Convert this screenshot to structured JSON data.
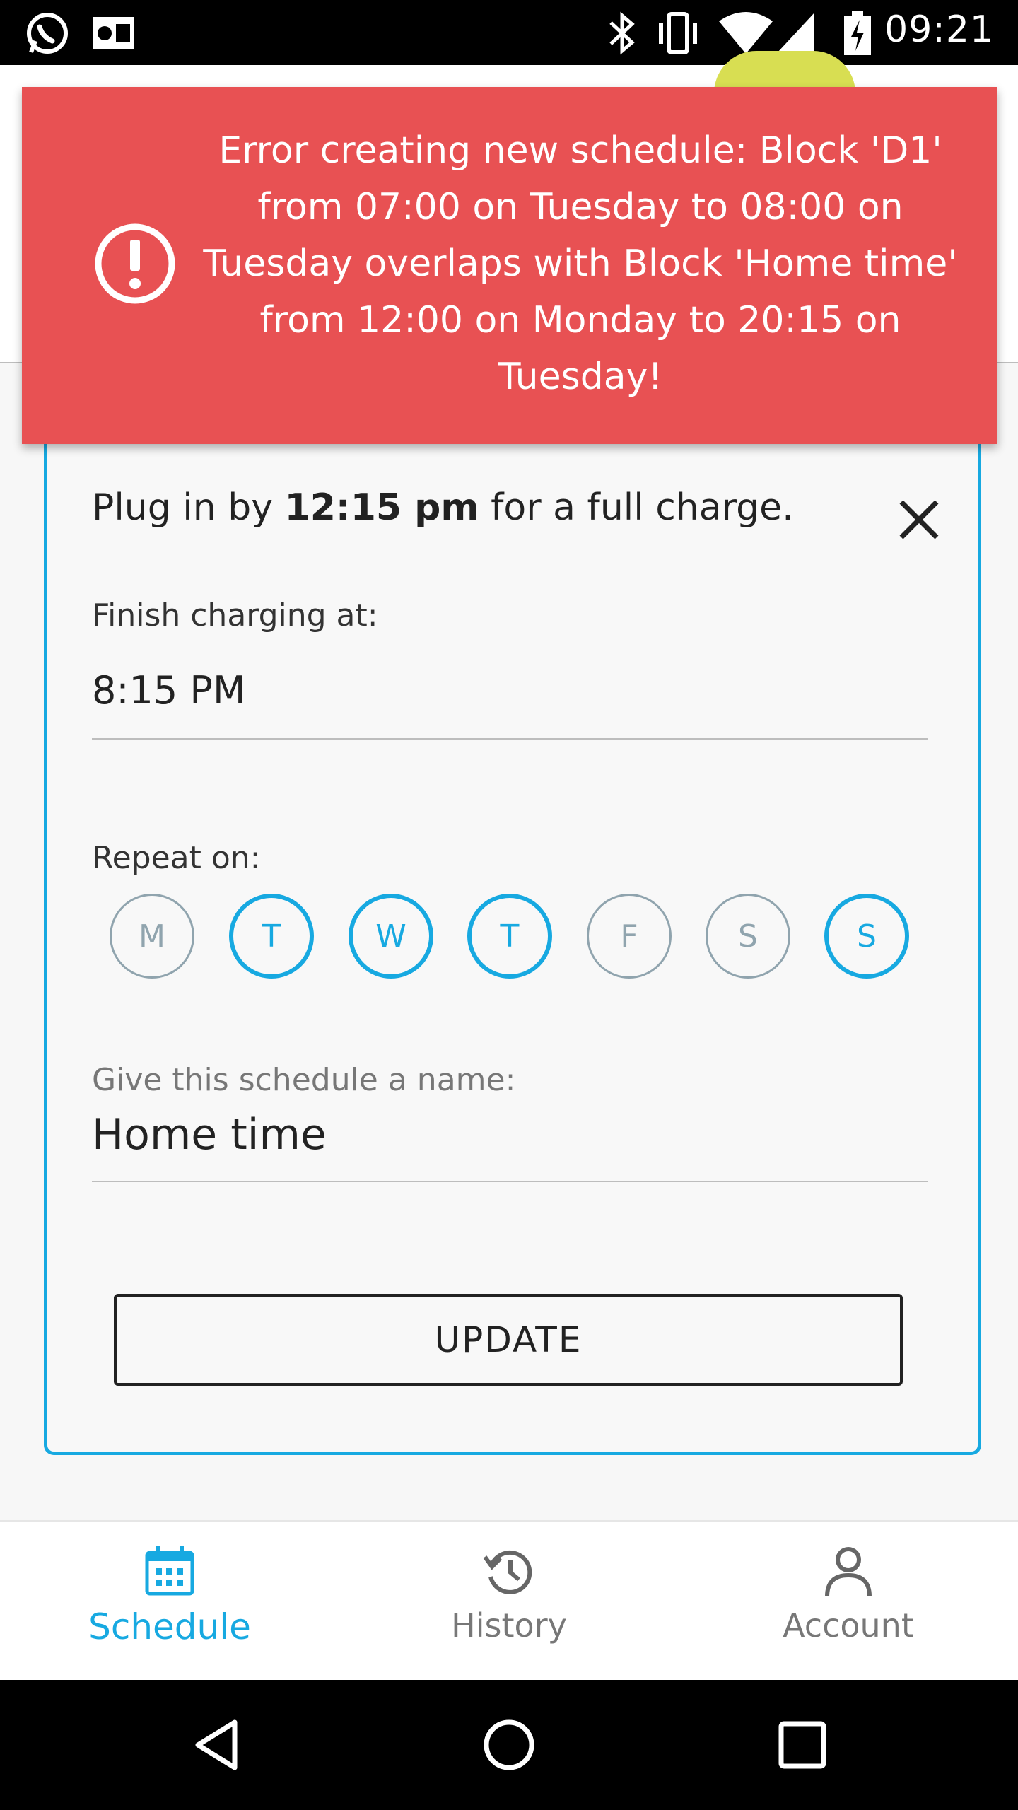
{
  "status_bar": {
    "time": "09:21",
    "left_icons": [
      "whatsapp-icon",
      "outlook-icon"
    ],
    "right_icons": [
      "bluetooth-icon",
      "vibrate-icon",
      "wifi-icon",
      "signal-icon",
      "battery-charging-icon"
    ]
  },
  "toast": {
    "icon": "error-icon",
    "message": "Error creating new schedule: Block 'D1' from 07:00 on Tuesday to 08:00 on Tuesday overlaps with Block 'Home time' from 12:00 on Monday to 20:15 on Tuesday!",
    "color": "#e85153"
  },
  "card": {
    "plug_prefix": "Plug in by ",
    "plug_time": "12:15 pm",
    "plug_suffix": " for a full charge.",
    "finish_label": "Finish charging at:",
    "finish_value": "8:15 PM",
    "repeat_label": "Repeat on:",
    "days": [
      {
        "label": "M",
        "selected": false
      },
      {
        "label": "T",
        "selected": true
      },
      {
        "label": "W",
        "selected": true
      },
      {
        "label": "T",
        "selected": true
      },
      {
        "label": "F",
        "selected": false
      },
      {
        "label": "S",
        "selected": false
      },
      {
        "label": "S",
        "selected": true
      }
    ],
    "name_label": "Give this schedule a name:",
    "name_value": "Home time",
    "update_label": "UPDATE",
    "accent_color": "#17a9e1"
  },
  "bottom_nav": {
    "items": [
      {
        "label": "Schedule",
        "icon": "calendar-icon",
        "active": true
      },
      {
        "label": "History",
        "icon": "history-icon",
        "active": false
      },
      {
        "label": "Account",
        "icon": "account-icon",
        "active": false
      }
    ]
  },
  "system_nav": [
    "back-icon",
    "home-icon",
    "recents-icon"
  ]
}
